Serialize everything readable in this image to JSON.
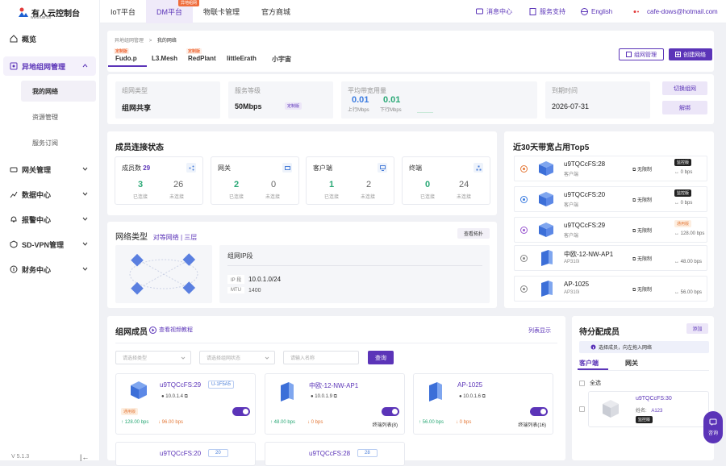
{
  "brand": {
    "name": "有人云控制台",
    "url": "www.usr.cn"
  },
  "sidebar": {
    "items": [
      {
        "label": "概览"
      },
      {
        "label": "异地组网管理"
      },
      {
        "label": "网关管理"
      },
      {
        "label": "数据中心"
      },
      {
        "label": "报警中心"
      },
      {
        "label": "SD-VPN管理"
      },
      {
        "label": "财务中心"
      }
    ],
    "sub": [
      "我的网络",
      "资源管理",
      "服务订阅"
    ],
    "version": "V 5.1.3",
    "collapse": "|←"
  },
  "topnav": {
    "tabs": [
      "IoT平台",
      "DM平台",
      "物联卡管理",
      "官方商城"
    ],
    "badge": "异地组网",
    "msg": "消息中心",
    "support": "服务支持",
    "lang": "English",
    "email": "cafe-dows@hotmail.com"
  },
  "breadcrumb": {
    "a": "异地组网管理",
    "sep": ">",
    "b": "我的网络"
  },
  "netTabs": [
    {
      "label": "Fudo.p",
      "tag": "定制版"
    },
    {
      "label": "L3.Mesh",
      "tag": ""
    },
    {
      "label": "RedPlant",
      "tag": "定制版"
    },
    {
      "label": "littleErath",
      "tag": ""
    },
    {
      "label": "小宇宙",
      "tag": ""
    }
  ],
  "actions": {
    "manage": "组网管理",
    "create": "创建网络",
    "switch": "切换组网",
    "unbind": "解绑",
    "topo": "查看拓扑",
    "video": "查看视频教程",
    "list": "列表显示",
    "add": "添加",
    "query": "查询"
  },
  "info": {
    "type_label": "组网类型",
    "type_val": "组网共享",
    "level_label": "服务等级",
    "level_val": "50Mbps",
    "level_tag": "定制版",
    "bw_label": "平均带宽用量",
    "up_val": "0.01",
    "up_unit": "上行Mbps",
    "dn_val": "0.01",
    "dn_unit": "下行Mbps",
    "exp_label": "到期时间",
    "exp_val": "2026-07-31"
  },
  "status": {
    "title": "成员连接状态",
    "boxes": [
      {
        "t": "成员数",
        "cnt": "29",
        "a": "3",
        "b": "26",
        "la": "已连接",
        "lb": "未连接"
      },
      {
        "t": "网关",
        "a": "2",
        "b": "0",
        "la": "已连接",
        "lb": "未连接"
      },
      {
        "t": "客户端",
        "a": "1",
        "b": "2",
        "la": "已连接",
        "lb": "未连接"
      },
      {
        "t": "终端",
        "a": "0",
        "b": "24",
        "la": "已连接",
        "lb": "未连接"
      }
    ]
  },
  "netType": {
    "title": "网络类型",
    "mode": "对等网络 | 三层",
    "seg": "组网IP段",
    "ip_label": "IP 段",
    "ip": "10.0.1.0/24",
    "mtu_label": "MTU",
    "mtu": "1400"
  },
  "top5": {
    "title": "近30天带宽占用Top5",
    "rows": [
      {
        "n": "u9TQCcFS:28",
        "t": "客户端",
        "lim": "无限制",
        "bps": "0 bps",
        "badge": "监控版"
      },
      {
        "n": "u9TQCcFS:20",
        "t": "客户端",
        "lim": "无限制",
        "bps": "0 bps",
        "badge": "监控版"
      },
      {
        "n": "u9TQCcFS:29",
        "t": "客户端",
        "lim": "无限制",
        "bps": "128.00 bps",
        "badge": "通用版"
      },
      {
        "n": "中欧-12-NW-AP1",
        "t": "AP310i",
        "lim": "无限制",
        "bps": "48.00 bps",
        "badge": ""
      },
      {
        "n": "AP-1025",
        "t": "AP310i",
        "lim": "无限制",
        "bps": "56.00 bps",
        "badge": ""
      }
    ]
  },
  "members": {
    "title": "组网成员",
    "filters": [
      "请选择类型",
      "请选择组网状态",
      "请输入名称"
    ],
    "cards": [
      {
        "n": "u9TQCcFS:29",
        "tag": "U-1F5A5",
        "ip": "10.0.1.4",
        "badge": "通用版",
        "up": "128.00 bps",
        "dn": "96.00 bps",
        "link": ""
      },
      {
        "n": "中欧-12-NW-AP1",
        "ip": "10.0.1.9",
        "up": "48.00 bps",
        "dn": "0 bps",
        "link": "终端列表(8)"
      },
      {
        "n": "AP-1025",
        "ip": "10.0.1.6",
        "up": "56.00 bps",
        "dn": "0 bps",
        "link": "终端列表(16)"
      },
      {
        "n": "u9TQCcFS:20",
        "tag": "20"
      },
      {
        "n": "u9TQCcFS:28",
        "tag": "28"
      }
    ]
  },
  "pending": {
    "title": "待分配成员",
    "tip": "选择成员，向左拖入网络",
    "tabs": [
      "客户端",
      "网关"
    ],
    "all": "全选",
    "item": {
      "n": "u9TQCcFS:30",
      "name_label": "姓名:",
      "name": "A123",
      "badge": "监控版"
    }
  },
  "chat": {
    "label": "咨询"
  }
}
